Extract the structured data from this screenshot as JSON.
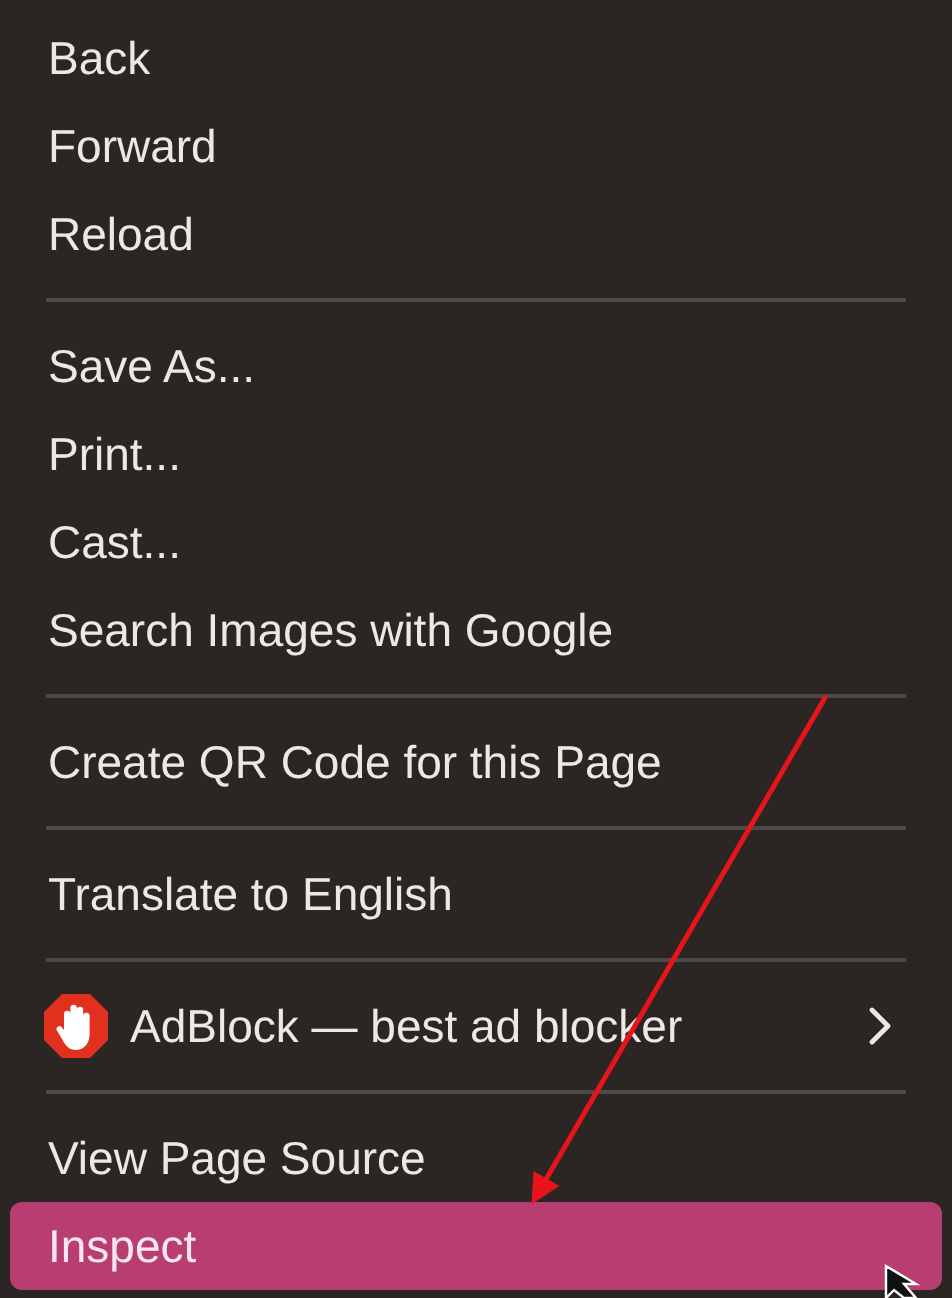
{
  "menu_groups": [
    {
      "items": [
        {
          "label": "Back",
          "kind": "plain",
          "selected": false
        },
        {
          "label": "Forward",
          "kind": "plain",
          "selected": false
        },
        {
          "label": "Reload",
          "kind": "plain",
          "selected": false
        }
      ]
    },
    {
      "items": [
        {
          "label": "Save As...",
          "kind": "plain",
          "selected": false
        },
        {
          "label": "Print...",
          "kind": "plain",
          "selected": false
        },
        {
          "label": "Cast...",
          "kind": "plain",
          "selected": false
        },
        {
          "label": "Search Images with Google",
          "kind": "plain",
          "selected": false
        }
      ]
    },
    {
      "items": [
        {
          "label": "Create QR Code for this Page",
          "kind": "plain",
          "selected": false
        }
      ]
    },
    {
      "items": [
        {
          "label": "Translate to English",
          "kind": "plain",
          "selected": false
        }
      ]
    },
    {
      "items": [
        {
          "label": "AdBlock — best ad blocker",
          "kind": "extension",
          "selected": false
        }
      ]
    },
    {
      "items": [
        {
          "label": "View Page Source",
          "kind": "plain",
          "selected": false
        },
        {
          "label": "Inspect",
          "kind": "plain",
          "selected": true
        }
      ]
    }
  ]
}
